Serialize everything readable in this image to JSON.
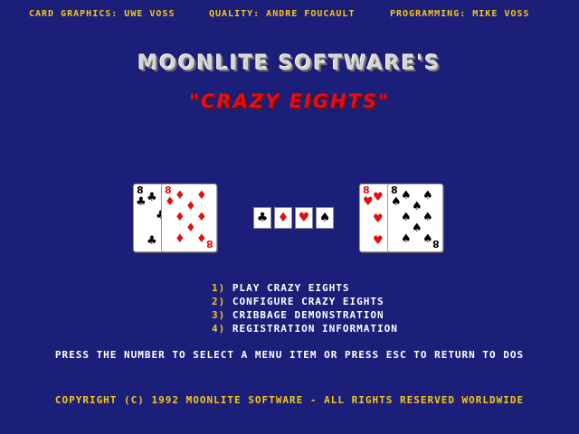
{
  "credits": {
    "card_graphics": "CARD GRAPHICS: UWE VOSS",
    "quality": "QUALITY: ANDRE FOUCAULT",
    "programming": "PROGRAMMING: MIKE VOSS"
  },
  "title": "MOONLITE SOFTWARE'S",
  "subtitle": "\"CRAZY EIGHTS\"",
  "cards": {
    "left_back_rank": "8",
    "left_front_rank": "8",
    "right_back_rank": "8",
    "right_front_rank": "8",
    "suits": {
      "club": "♣",
      "diamond": "♦",
      "heart": "♥",
      "spade": "♠"
    }
  },
  "suit_selector": [
    "♣",
    "♦",
    "♥",
    "♠"
  ],
  "menu": {
    "items": [
      {
        "num": "1)",
        "label": "PLAY CRAZY EIGHTS"
      },
      {
        "num": "2)",
        "label": "CONFIGURE CRAZY EIGHTS"
      },
      {
        "num": "3)",
        "label": "CRIBBAGE DEMONSTRATION"
      },
      {
        "num": "4)",
        "label": "REGISTRATION INFORMATION"
      }
    ]
  },
  "instruction": "PRESS THE NUMBER TO SELECT A MENU ITEM OR PRESS ESC TO RETURN TO DOS",
  "copyright": "COPYRIGHT (C) 1992 MOONLITE SOFTWARE - ALL RIGHTS RESERVED WORLDWIDE",
  "colors": {
    "background": "#1c1f7a",
    "accent_yellow": "#f7c518",
    "title_red": "#e01010",
    "menu_text": "#ffffff"
  }
}
